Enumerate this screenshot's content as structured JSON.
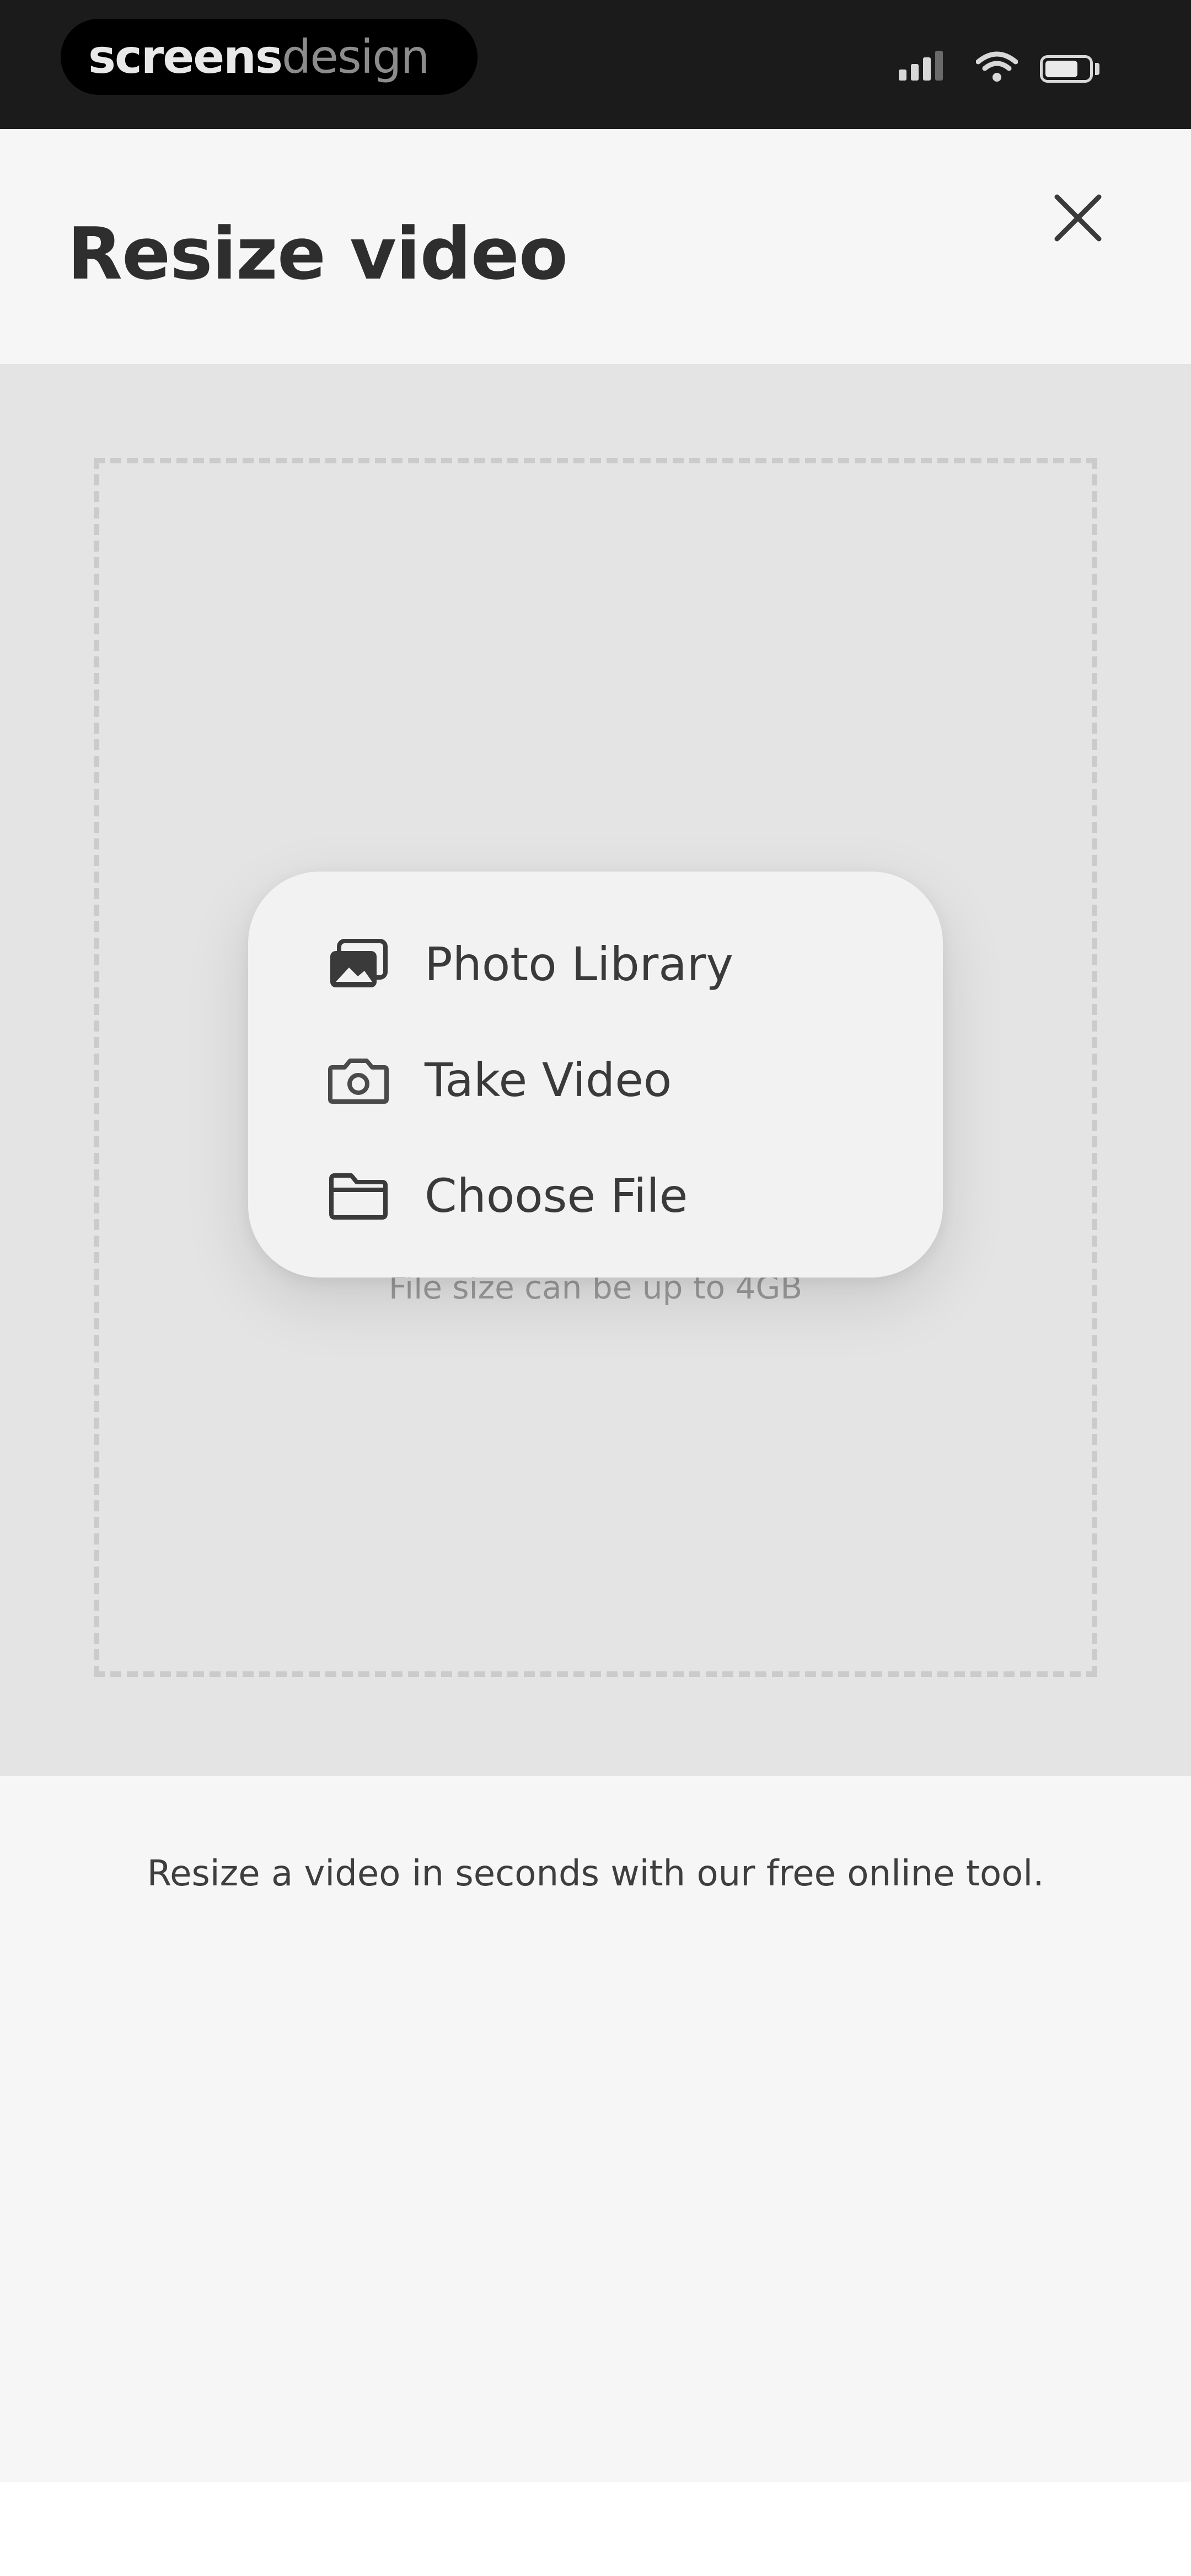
{
  "status_bar": {
    "brand_bold": "screens",
    "brand_light": "design",
    "icons": [
      "signal-icon",
      "wifi-icon",
      "battery-icon"
    ]
  },
  "header": {
    "title": "Resize video",
    "close_icon": "close-icon"
  },
  "upload": {
    "hint": "File size can be up to 4GB"
  },
  "menu": {
    "items": [
      {
        "label": "Photo Library",
        "icon": "photo-library-icon"
      },
      {
        "label": "Take Video",
        "icon": "camera-icon"
      },
      {
        "label": "Choose File",
        "icon": "folder-icon"
      }
    ]
  },
  "description": "Resize a video in seconds with our free online tool.",
  "colors": {
    "status_bar_bg": "#1b1b1b",
    "header_bg": "#f6f6f6",
    "upload_bg": "#e4e4e4",
    "menu_bg": "#f2f2f2"
  }
}
